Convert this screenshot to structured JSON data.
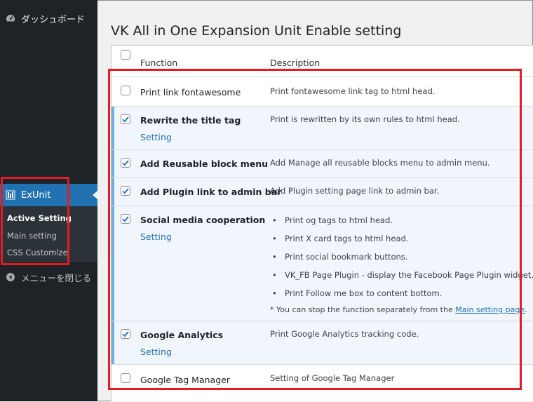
{
  "sidebar": {
    "dashboard_label": "ダッシュボード",
    "exunit_label": "ExUnit",
    "submenu": [
      "Active Setting",
      "Main setting",
      "CSS Customize"
    ],
    "collapse_label": "メニューを閉じる"
  },
  "page": {
    "title": "VK All in One Expansion Unit Enable setting"
  },
  "table": {
    "col_function": "Function",
    "col_description": "Description",
    "rows": [
      {
        "name": "Print link fontawesome",
        "checked": false,
        "description": "Print fontawesome link tag to html head."
      },
      {
        "name": "Rewrite the title tag",
        "checked": true,
        "setting": "Setting",
        "description": "Print is rewritten by its own rules to html head."
      },
      {
        "name": "Add Reusable block menu",
        "checked": true,
        "description": "Add Manage all reusable blocks menu to admin menu."
      },
      {
        "name": "Add Plugin link to admin bar",
        "checked": true,
        "description": "Add Plugin setting page link to admin bar."
      },
      {
        "name": "Social media cooperation",
        "checked": true,
        "setting": "Setting",
        "bullets": [
          "Print og tags to html head.",
          "Print X card tags to html head.",
          "Print social bookmark buttons.",
          "VK_FB Page Plugin - display the Facebook Page Plugin widget.",
          "Print Follow me box to content bottom."
        ],
        "note_prefix": "* You can stop the function separately from the ",
        "note_link": "Main setting page",
        "note_suffix": "."
      },
      {
        "name": "Google Analytics",
        "checked": true,
        "setting": "Setting",
        "description": "Print Google Analytics tracking code."
      },
      {
        "name": "Google Tag Manager",
        "checked": false,
        "description": "Setting of Google Tag Manager"
      }
    ]
  },
  "colors": {
    "sidebar_bg": "#1d2327",
    "accent": "#2271b1",
    "highlight_box": "#e31b23"
  }
}
